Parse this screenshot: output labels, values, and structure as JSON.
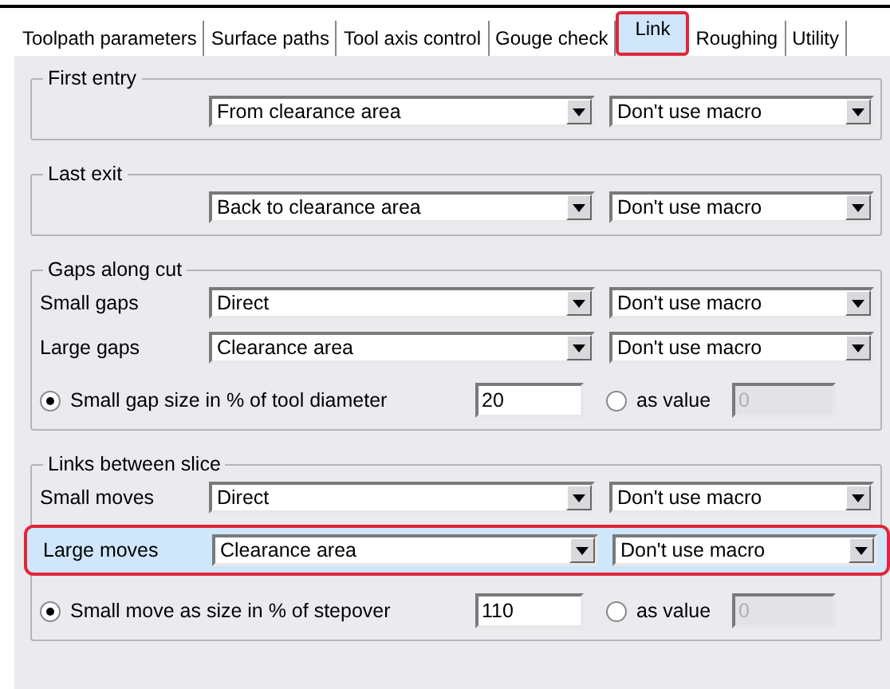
{
  "tabs": [
    {
      "label": "Toolpath parameters",
      "selected": false,
      "highlighted": false
    },
    {
      "label": "Surface paths",
      "selected": false,
      "highlighted": false
    },
    {
      "label": "Tool axis control",
      "selected": false,
      "highlighted": false
    },
    {
      "label": "Gouge check",
      "selected": false,
      "highlighted": false
    },
    {
      "label": "Link",
      "selected": true,
      "highlighted": true
    },
    {
      "label": "Roughing",
      "selected": false,
      "highlighted": false
    },
    {
      "label": "Utility",
      "selected": false,
      "highlighted": false
    }
  ],
  "groups": [
    {
      "title": "First entry",
      "rows": [
        {
          "kind": "select",
          "highlighted": false,
          "method": "From clearance area",
          "macro": "Don't use macro"
        }
      ]
    },
    {
      "title": "Last exit",
      "rows": [
        {
          "kind": "select",
          "highlighted": false,
          "method": "Back to clearance area",
          "macro": "Don't use macro"
        }
      ]
    },
    {
      "title": "Gaps along cut",
      "rows": [
        {
          "kind": "select",
          "highlighted": false,
          "label": "Small gaps",
          "method": "Direct",
          "macro": "Don't use macro"
        },
        {
          "kind": "select",
          "highlighted": false,
          "label": "Large gaps",
          "method": "Clearance area",
          "macro": "Don't use macro"
        },
        {
          "kind": "size",
          "label": "Small gap size in % of tool diameter",
          "selected": true,
          "value": "20",
          "alt_label": "as value",
          "alt_selected": false,
          "alt_value": "0",
          "alt_disabled": true
        }
      ]
    },
    {
      "title": "Links between slice",
      "rows": [
        {
          "kind": "select",
          "highlighted": false,
          "label": "Small moves",
          "method": "Direct",
          "macro": "Don't use macro"
        },
        {
          "kind": "select",
          "highlighted": true,
          "label": "Large moves",
          "method": "Clearance area",
          "macro": "Don't use macro"
        },
        {
          "kind": "size",
          "label": "Small move as size in % of stepover",
          "selected": true,
          "value": "110",
          "alt_label": "as value",
          "alt_selected": false,
          "alt_value": "0",
          "alt_disabled": true
        }
      ]
    }
  ]
}
